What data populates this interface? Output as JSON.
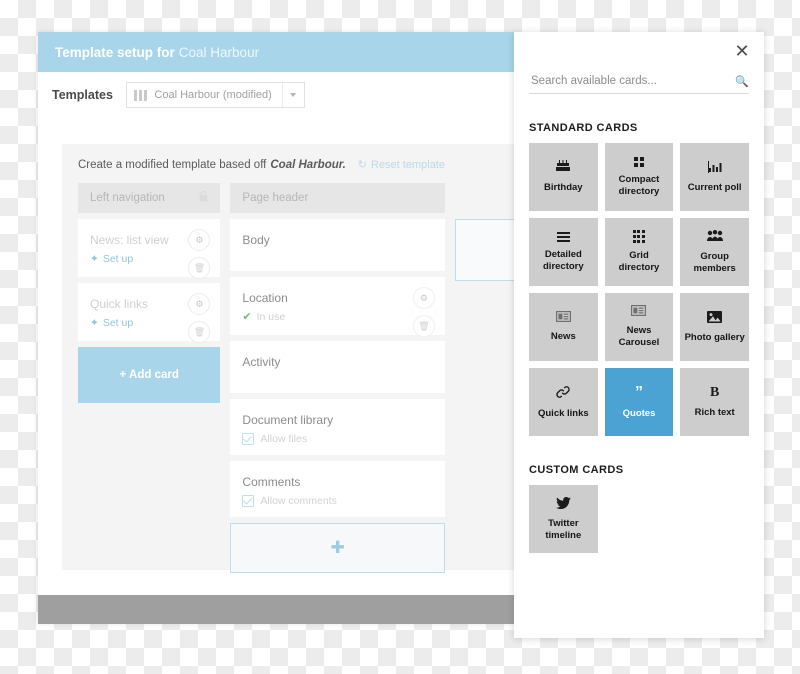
{
  "window": {
    "header": {
      "title_strong": "Template setup for",
      "title_light": "Coal Harbour"
    },
    "templates": {
      "label": "Templates",
      "selected": "Coal Harbour (modified)",
      "icon": "template-columns-icon",
      "caret": "chevron-down-icon"
    },
    "hint": {
      "prefix": "Create a modified template based off",
      "emphasis": "Coal Harbour.",
      "reset_label": "Reset template",
      "reset_icon": "reload-icon"
    },
    "columns": [
      {
        "name": "left-navigation",
        "header": "Left navigation",
        "locked": true,
        "lock_icon": "lock-icon",
        "cards": [
          {
            "title": "News: list view",
            "sub": "Set up",
            "sub_type": "setup",
            "actions": [
              "gear-icon",
              "trash-icon"
            ]
          },
          {
            "title": "Quick links",
            "sub": "Set up",
            "sub_type": "setup",
            "actions": [
              "gear-icon",
              "trash-icon"
            ]
          }
        ],
        "add_button": "+ Add card"
      },
      {
        "name": "page-header",
        "header": "Page header",
        "cards": [
          {
            "title": "Body",
            "sub": "",
            "sub_type": "none",
            "actions": []
          },
          {
            "title": "Location",
            "sub": "In use",
            "sub_type": "inuse",
            "actions": [
              "gear-icon",
              "trash-icon"
            ]
          },
          {
            "title": "Activity",
            "sub": "",
            "sub_type": "none",
            "actions": []
          },
          {
            "title": "Document library",
            "sub": "Allow files",
            "sub_type": "allow",
            "actions": []
          },
          {
            "title": "Comments",
            "sub": "Allow comments",
            "sub_type": "allow",
            "actions": []
          }
        ],
        "add_slot_icon": "plus-icon"
      }
    ]
  },
  "panel": {
    "close_icon": "close-icon",
    "search": {
      "placeholder": "Search available cards...",
      "value": "",
      "icon": "search-icon"
    },
    "sections": [
      {
        "title": "STANDARD CARDS",
        "cards": [
          {
            "label": "Birthday",
            "icon": "cake-icon",
            "selected": false
          },
          {
            "label": "Compact directory",
            "icon": "grid-2x2-icon",
            "selected": false
          },
          {
            "label": "Current poll",
            "icon": "bar-chart-icon",
            "selected": false
          },
          {
            "label": "Detailed directory",
            "icon": "list-lines-icon",
            "selected": false
          },
          {
            "label": "Grid directory",
            "icon": "grid-3x3-icon",
            "selected": false
          },
          {
            "label": "Group members",
            "icon": "people-icon",
            "selected": false
          },
          {
            "label": "News",
            "icon": "news-icon",
            "selected": false
          },
          {
            "label": "News Carousel",
            "icon": "news-icon",
            "selected": false
          },
          {
            "label": "Photo gallery",
            "icon": "image-icon",
            "selected": false
          },
          {
            "label": "Quick links",
            "icon": "link-icon",
            "selected": false
          },
          {
            "label": "Quotes",
            "icon": "quote-icon",
            "selected": true
          },
          {
            "label": "Rich text",
            "icon": "bold-b-icon",
            "selected": false
          }
        ]
      },
      {
        "title": "CUSTOM CARDS",
        "cards": [
          {
            "label": "Twitter timeline",
            "icon": "twitter-bird-icon",
            "selected": false
          }
        ]
      }
    ]
  },
  "colors": {
    "accent_blue": "#a8d5e9",
    "selected_blue": "#4ba3d3",
    "card_gray": "#cdcdcd",
    "footer_gray": "#9f9f9f"
  }
}
